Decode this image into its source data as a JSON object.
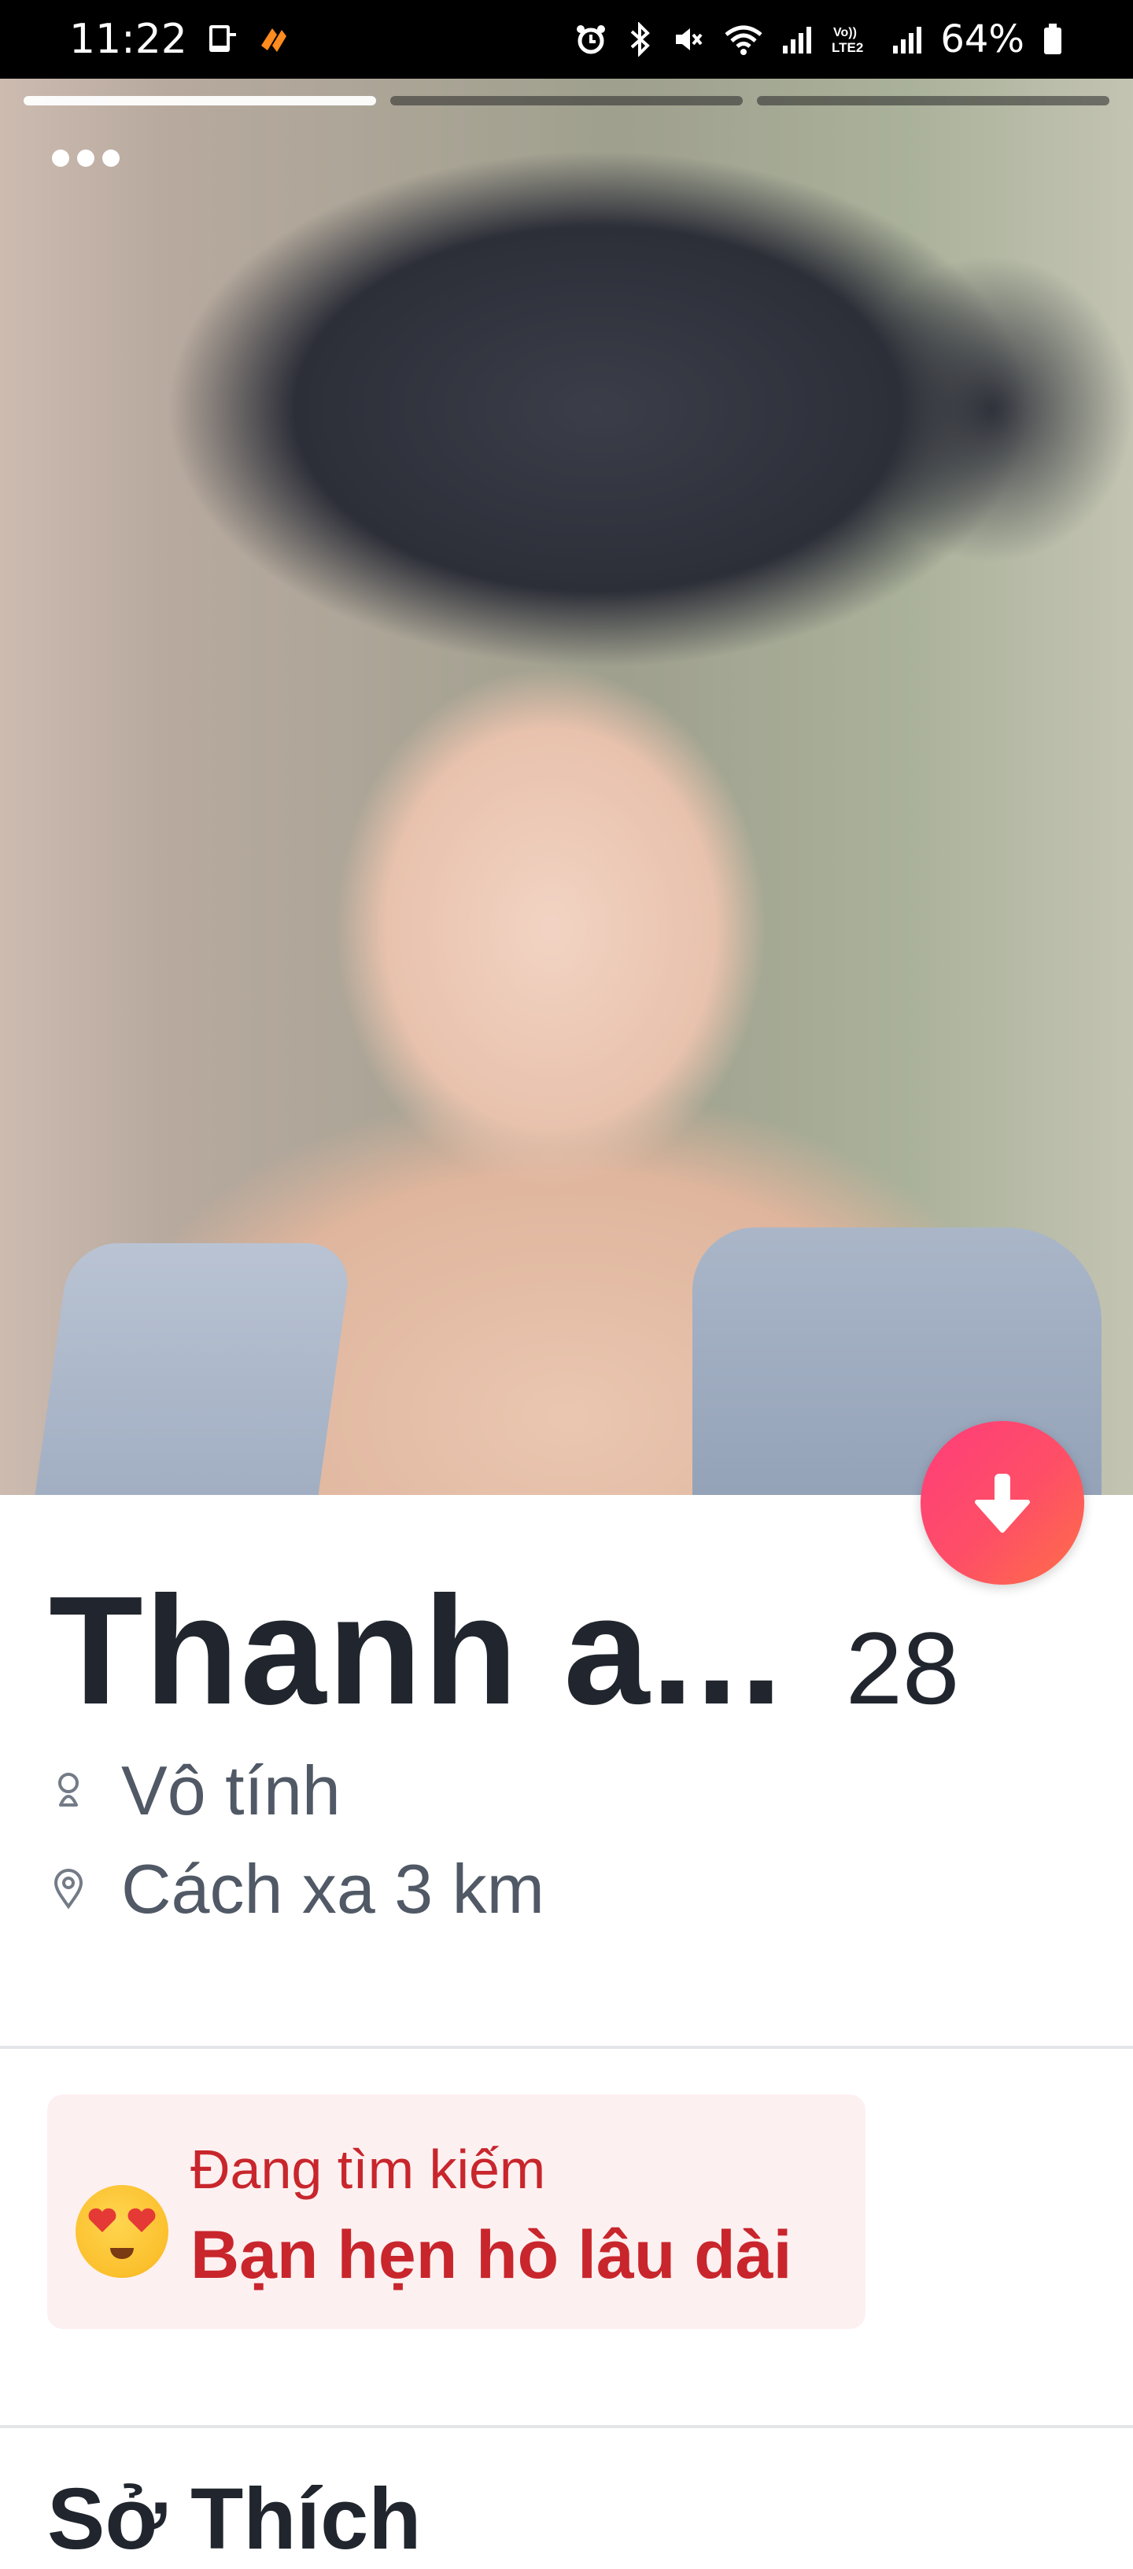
{
  "status_bar": {
    "time": "11:22",
    "battery_percent": "64%",
    "icons": [
      "sim-notify-icon",
      "app-notify-icon",
      "alarm-icon",
      "bluetooth-icon",
      "mute-icon",
      "wifi-icon",
      "signal-icon",
      "volte-icon",
      "signal-icon",
      "battery-icon"
    ]
  },
  "photo": {
    "photo_count": 3,
    "active_index": 0,
    "menu_icon": "more-dots-icon"
  },
  "profile": {
    "name": "Thanh a...",
    "age": "28",
    "gender_icon": "gender-icon",
    "gender": "Vô tính",
    "distance_icon": "location-pin-icon",
    "distance": "Cách xa 3 km"
  },
  "looking_for": {
    "emoji": "heart-eyes-emoji",
    "label": "Đang tìm kiếm",
    "value": "Bạn hẹn hò lâu dài"
  },
  "sections": {
    "interests_title": "Sở Thích"
  },
  "colors": {
    "accent_gradient_start": "#ff3d7a",
    "accent_gradient_end": "#ff6f47",
    "looking_text": "#c8262c",
    "looking_bg": "#fdf0f1"
  }
}
